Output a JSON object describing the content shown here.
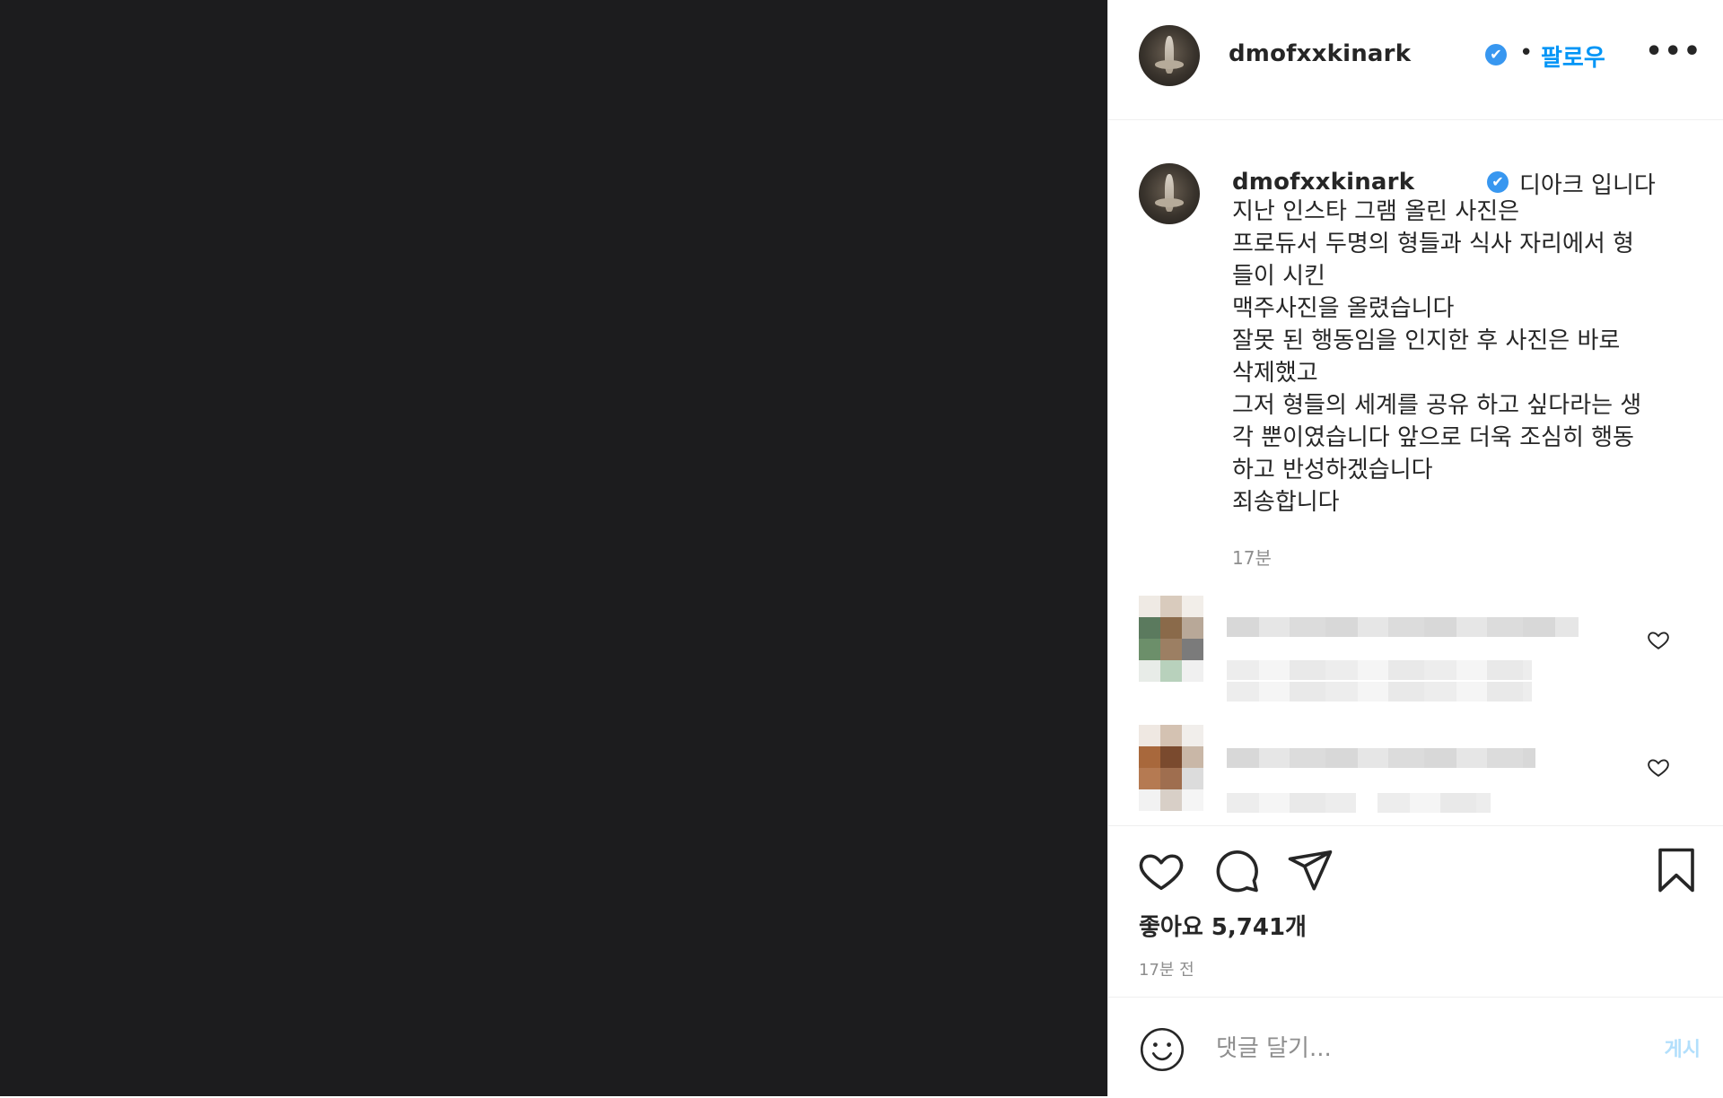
{
  "post": {
    "username": "dmofxxkinark",
    "verified_icon": "✔",
    "separator": "•",
    "follow_label": "팔로우",
    "more_label": "•••"
  },
  "caption": {
    "username": "dmofxxkinark",
    "verified_icon": "✔",
    "lines": [
      "디아크 입니다",
      "지난 인스타 그램 올린 사진은",
      "프로듀서 두명의 형들과 식사 자리에서 형",
      "들이 시킨",
      "맥주사진을 올렸습니다",
      "잘못 된 행동임을 인지한 후 사진은 바로",
      "삭제했고",
      "그저 형들의 세계를 공유 하고 싶다라는 생",
      "각 뿐이였습니다 앞으로 더욱 조심히 행동",
      "하고 반성하겠습니다",
      "죄송합니다"
    ],
    "time": "17분"
  },
  "likes": "좋아요 5,741개",
  "post_time": "17분 전",
  "comment_box": {
    "placeholder": "댓글 달기...",
    "post_label": "게시"
  },
  "icons": {
    "heart": "heart-icon",
    "comment": "comment-icon",
    "share": "paper-plane-icon",
    "save": "bookmark-icon",
    "emoji": "smiley-icon",
    "more": "more-options-icon"
  },
  "colors": {
    "media_bg": "#1c1c1e",
    "link_blue": "#0095f6",
    "verified_blue": "#3897f0",
    "post_disabled": "#b2dffc"
  }
}
